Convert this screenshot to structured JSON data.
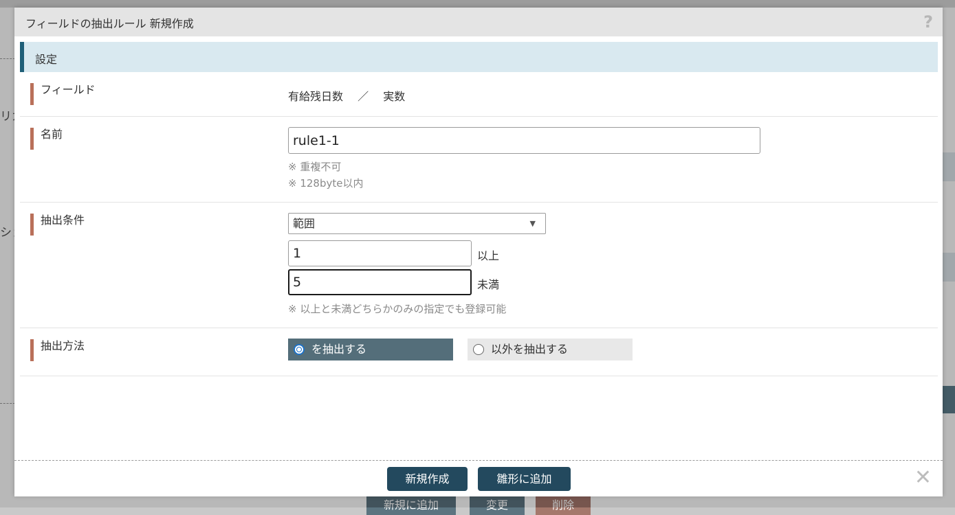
{
  "background": {
    "left_texts": [
      "リカ",
      "ショ"
    ],
    "buttons": [
      {
        "label": "新規に追加",
        "color": "#5c7480"
      },
      {
        "label": "変更",
        "color": "#5c7480"
      },
      {
        "label": "削除",
        "color": "#a5786c"
      }
    ]
  },
  "modal": {
    "title": "フィールドの抽出ルール 新規作成",
    "help_icon": "?",
    "section_title": "設定",
    "field": {
      "label": "フィールド",
      "value_name": "有給残日数",
      "separator": "／",
      "value_type": "実数"
    },
    "name": {
      "label": "名前",
      "value": "rule1-1",
      "notes": [
        "※ 重複不可",
        "※ 128byte以内"
      ]
    },
    "condition": {
      "label": "抽出条件",
      "selected": "範囲",
      "min_value": "1",
      "min_unit": "以上",
      "max_value": "5",
      "max_unit": "未満",
      "note": "※ 以上と未満どちらかのみの指定でも登録可能"
    },
    "method": {
      "label": "抽出方法",
      "options": [
        {
          "label": "を抽出する",
          "selected": true
        },
        {
          "label": "以外を抽出する",
          "selected": false
        }
      ]
    },
    "footer": {
      "create_label": "新規作成",
      "template_label": "雛形に追加",
      "close_icon": "✕"
    }
  },
  "colors": {
    "accent": "#1f5f78",
    "label_bar": "#b9705a",
    "button": "#23495e",
    "radio_active": "#546e7a"
  }
}
